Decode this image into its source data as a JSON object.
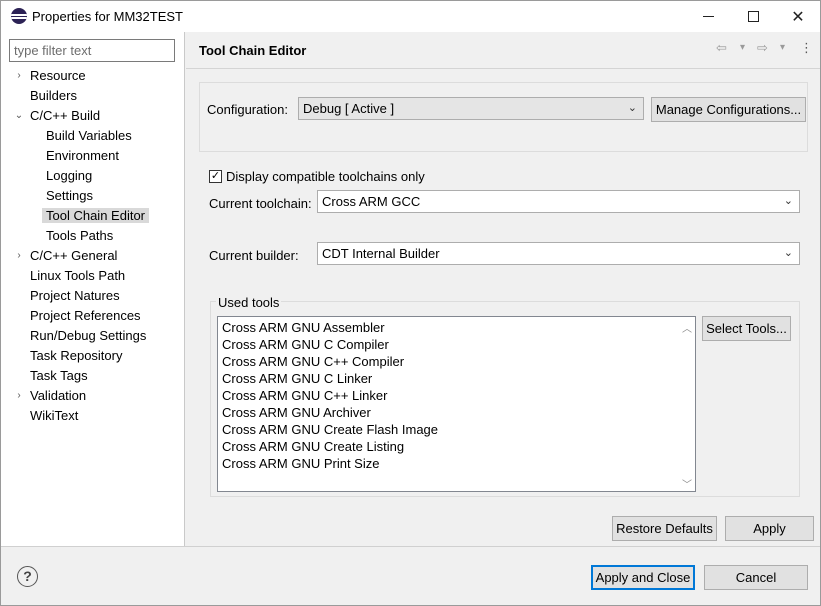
{
  "window": {
    "title": "Properties for MM32TEST",
    "minimize_glyph": "",
    "maximize_glyph": "",
    "close_glyph": "✕"
  },
  "sidebar": {
    "filter_placeholder": "type filter text",
    "items": [
      {
        "label": "Resource",
        "arrow": "›"
      },
      {
        "label": "Builders",
        "arrow": ""
      },
      {
        "label": "C/C++ Build",
        "arrow": "⌄"
      },
      {
        "label": "Build Variables",
        "arrow": ""
      },
      {
        "label": "Environment",
        "arrow": ""
      },
      {
        "label": "Logging",
        "arrow": ""
      },
      {
        "label": "Settings",
        "arrow": ""
      },
      {
        "label": "Tool Chain Editor",
        "arrow": "",
        "selected": true
      },
      {
        "label": "Tools Paths",
        "arrow": ""
      },
      {
        "label": "C/C++ General",
        "arrow": "›"
      },
      {
        "label": "Linux Tools Path",
        "arrow": ""
      },
      {
        "label": "Project Natures",
        "arrow": ""
      },
      {
        "label": "Project References",
        "arrow": ""
      },
      {
        "label": "Run/Debug Settings",
        "arrow": ""
      },
      {
        "label": "Task Repository",
        "arrow": ""
      },
      {
        "label": "Task Tags",
        "arrow": ""
      },
      {
        "label": "Validation",
        "arrow": "›"
      },
      {
        "label": "WikiText",
        "arrow": ""
      }
    ]
  },
  "page": {
    "title": "Tool Chain Editor",
    "nav": {
      "back_glyph": "⇦",
      "back_menu_glyph": "▾",
      "forward_glyph": "⇨",
      "forward_menu_glyph": "▾",
      "more_glyph": "⋮"
    },
    "configuration": {
      "label": "Configuration:",
      "value": "Debug  [ Active ]",
      "manage_button": "Manage Configurations..."
    },
    "compatible_only": {
      "label": "Display compatible toolchains only",
      "checked": true,
      "check_glyph": "✓"
    },
    "toolchain": {
      "label": "Current toolchain:",
      "value": "Cross ARM GCC"
    },
    "builder": {
      "label": "Current builder:",
      "value": "CDT Internal Builder"
    },
    "used_tools": {
      "title": "Used tools",
      "items": [
        "Cross ARM GNU Assembler",
        "Cross ARM GNU C Compiler",
        "Cross ARM GNU C++ Compiler",
        "Cross ARM GNU C Linker",
        "Cross ARM GNU C++ Linker",
        "Cross ARM GNU Archiver",
        "Cross ARM GNU Create Flash Image",
        "Cross ARM GNU Create Listing",
        "Cross ARM GNU Print Size"
      ],
      "select_button": "Select Tools..."
    },
    "restore_defaults": "Restore Defaults",
    "apply": "Apply"
  },
  "footer": {
    "help_glyph": "?",
    "apply_and_close": "Apply and Close",
    "cancel": "Cancel"
  },
  "icons": {
    "chevron": "⌄",
    "scroll_up": "︿",
    "scroll_down": "﹀"
  }
}
